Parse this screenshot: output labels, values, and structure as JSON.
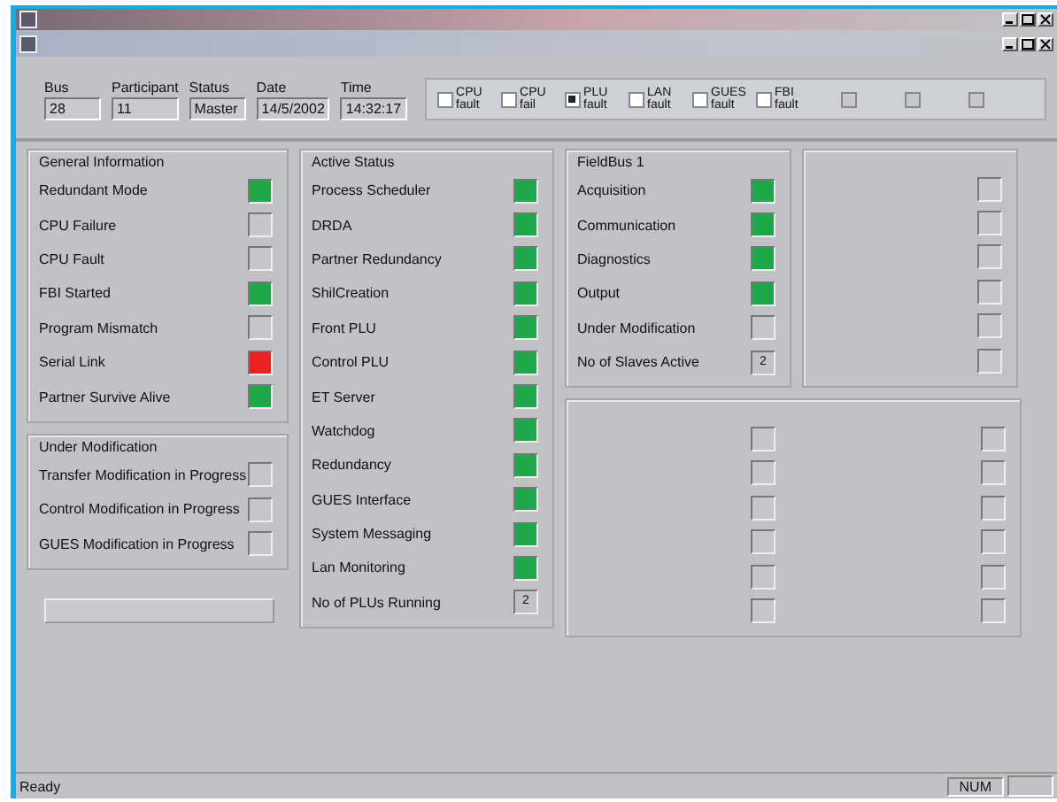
{
  "header_fields": [
    {
      "label": "Bus",
      "value": "28"
    },
    {
      "label": "Participant",
      "value": "11"
    },
    {
      "label": "Status",
      "value": "Master"
    },
    {
      "label": "Date",
      "value": "14/5/2002"
    },
    {
      "label": "Time",
      "value": "14:32:17"
    }
  ],
  "fault_checkboxes": [
    {
      "label": "CPU fault",
      "checked": false,
      "disabled": false
    },
    {
      "label": "CPU fail",
      "checked": false,
      "disabled": false
    },
    {
      "label": "PLU fault",
      "checked": true,
      "disabled": false
    },
    {
      "label": "LAN fault",
      "checked": false,
      "disabled": false
    },
    {
      "label": "GUES fault",
      "checked": false,
      "disabled": false
    },
    {
      "label": "FBI fault",
      "checked": false,
      "disabled": false
    },
    {
      "checked": false,
      "disabled": true
    },
    {
      "checked": false,
      "disabled": true
    },
    {
      "checked": false,
      "disabled": true
    }
  ],
  "general_information": {
    "title": "General Information",
    "items": [
      {
        "label": "Redundant Mode",
        "lit": true,
        "color": "#1fa84a"
      },
      {
        "label": "CPU Failure",
        "lit": false
      },
      {
        "label": "CPU Fault",
        "lit": false
      },
      {
        "label": "FBI Started",
        "lit": true,
        "color": "#1fa84a"
      },
      {
        "label": "Program Mismatch",
        "lit": false
      },
      {
        "label": "Serial Link",
        "lit": true,
        "color": "#ec2020"
      },
      {
        "label": "Partner Survive Alive",
        "lit": true,
        "color": "#1fa84a"
      }
    ]
  },
  "under_modification": {
    "title": "Under Modification",
    "items": [
      {
        "label": "Transfer Modification in Progress",
        "lit": false
      },
      {
        "label": "Control Modification in Progress",
        "lit": false
      },
      {
        "label": "GUES Modification in Progress",
        "lit": false
      }
    ]
  },
  "disabled_button": {
    "disabled": true
  },
  "active_status": {
    "title": "Active Status",
    "items": [
      {
        "label": "Process Scheduler",
        "kind": "led",
        "lit": true,
        "color": "#1fa84a"
      },
      {
        "label": "DRDA",
        "kind": "led",
        "lit": true,
        "color": "#1fa84a"
      },
      {
        "label": "Partner Redundancy",
        "kind": "led",
        "lit": true,
        "color": "#1fa84a"
      },
      {
        "label": "ShilCreation",
        "kind": "led",
        "lit": true,
        "color": "#1fa84a"
      },
      {
        "label": "Front PLU",
        "kind": "led",
        "lit": true,
        "color": "#1fa84a"
      },
      {
        "label": "Control PLU",
        "kind": "led",
        "lit": true,
        "color": "#1fa84a"
      },
      {
        "label": "ET Server",
        "kind": "led",
        "lit": true,
        "color": "#1fa84a"
      },
      {
        "label": "Watchdog",
        "kind": "led",
        "lit": true,
        "color": "#1fa84a"
      },
      {
        "label": "Redundancy",
        "kind": "led",
        "lit": true,
        "color": "#1fa84a"
      },
      {
        "label": "GUES Interface",
        "kind": "led",
        "lit": true,
        "color": "#1fa84a"
      },
      {
        "label": "System Messaging",
        "kind": "led",
        "lit": true,
        "color": "#1fa84a"
      },
      {
        "label": "Lan Monitoring",
        "kind": "led",
        "lit": true,
        "color": "#1fa84a"
      },
      {
        "label": "No of PLUs Running",
        "kind": "count",
        "value": "2"
      }
    ]
  },
  "fieldbus_1": {
    "title": "FieldBus 1",
    "items": [
      {
        "label": "Acquisition",
        "kind": "led",
        "lit": true,
        "color": "#1fa84a"
      },
      {
        "label": "Communication",
        "kind": "led",
        "lit": true,
        "color": "#1fa84a"
      },
      {
        "label": "Diagnostics",
        "kind": "led",
        "lit": true,
        "color": "#1fa84a"
      },
      {
        "label": "Output",
        "kind": "led",
        "lit": true,
        "color": "#1fa84a"
      },
      {
        "label": "Under Modification",
        "kind": "led",
        "lit": false
      },
      {
        "label": "No of Slaves Active",
        "kind": "count",
        "value": "2"
      }
    ],
    "column_2": [
      {
        "lit": false
      },
      {
        "lit": false
      },
      {
        "lit": false
      },
      {
        "lit": false
      },
      {
        "lit": false
      },
      {
        "lit": false
      }
    ]
  },
  "inactive_group": {
    "column_1": [
      {
        "lit": false
      },
      {
        "lit": false
      },
      {
        "lit": false
      },
      {
        "lit": false
      },
      {
        "lit": false
      },
      {
        "lit": false
      }
    ],
    "column_2": [
      {
        "lit": false
      },
      {
        "lit": false
      },
      {
        "lit": false
      },
      {
        "lit": false
      },
      {
        "lit": false
      },
      {
        "lit": false
      }
    ]
  },
  "status_bar": {
    "message": "Ready",
    "indicator": "NUM"
  }
}
